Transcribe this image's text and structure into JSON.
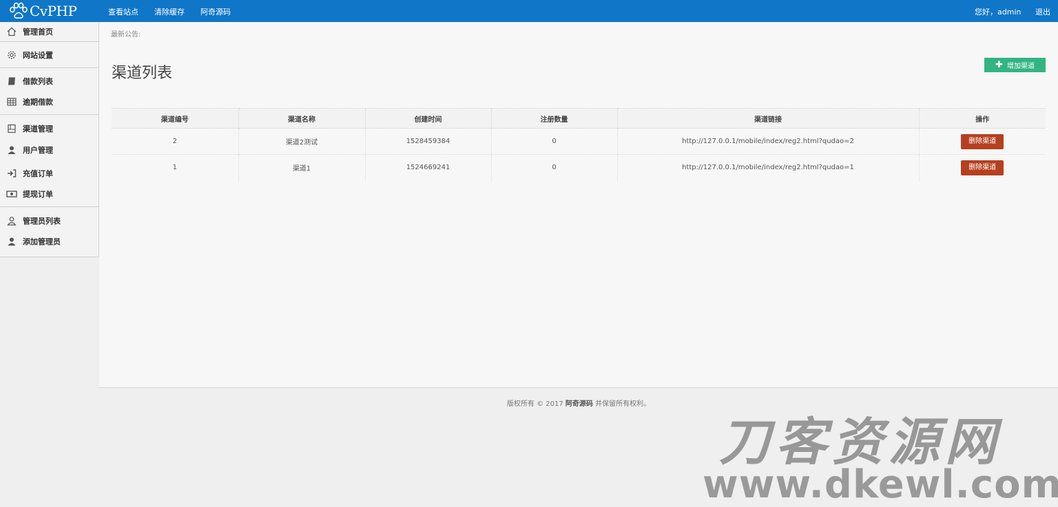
{
  "brand": {
    "name": "CvPHP"
  },
  "topnav": {
    "links": [
      "查看站点",
      "清除缓存",
      "阿奇源码"
    ],
    "greeting": "您好，admin",
    "logout": "退出"
  },
  "sidebar": {
    "items": [
      {
        "label": "管理首页",
        "icon": "home-icon"
      },
      {
        "label": "网站设置",
        "icon": "gear-icon"
      },
      {
        "label": "借款列表",
        "icon": "book-icon"
      },
      {
        "label": "逾期借款",
        "icon": "grid-icon"
      },
      {
        "label": "渠道管理",
        "icon": "box-icon"
      },
      {
        "label": "用户管理",
        "icon": "user-icon"
      },
      {
        "label": "充值订单",
        "icon": "signin-icon"
      },
      {
        "label": "提现订单",
        "icon": "money-icon"
      },
      {
        "label": "管理员列表",
        "icon": "user-outline-icon"
      },
      {
        "label": "添加管理员",
        "icon": "user-icon"
      }
    ]
  },
  "main": {
    "notice": "最新公告:",
    "title": "渠道列表",
    "add_button": "增加渠道",
    "table": {
      "headers": [
        "渠道编号",
        "渠道名称",
        "创建时间",
        "注册数量",
        "渠道链接",
        "操作"
      ],
      "rows": [
        {
          "id": "2",
          "name": "渠道2测试",
          "created": "1528459384",
          "count": "0",
          "link": "http://127.0.0.1/mobile/index/reg2.html?qudao=2",
          "action": "删除渠道"
        },
        {
          "id": "1",
          "name": "渠道1",
          "created": "1524669241",
          "count": "0",
          "link": "http://127.0.0.1/mobile/index/reg2.html?qudao=1",
          "action": "删除渠道"
        }
      ]
    }
  },
  "footer": {
    "prefix": "版权所有 © 2017",
    "brand": "阿奇源码",
    "suffix": "并保留所有权利。"
  },
  "watermark": {
    "cn": "刀客资源网",
    "en": "www.dkewl.com"
  },
  "colors": {
    "navbar": "#0f76c8",
    "add_button": "#32b483",
    "delete_button": "#b5401f"
  }
}
